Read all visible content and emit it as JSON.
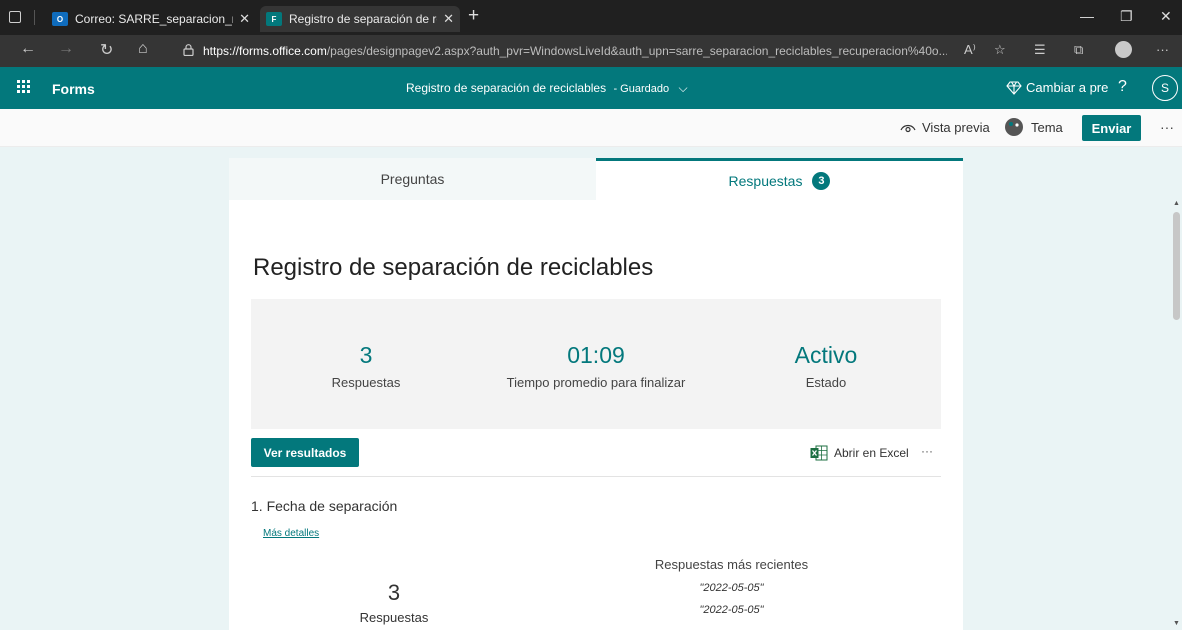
{
  "browser": {
    "tabs": [
      {
        "label": "Correo: SARRE_separacion_recicl",
        "icon": "outlook-icon"
      },
      {
        "label": "Registro de separación de recicla",
        "icon": "forms-icon"
      }
    ],
    "url_domain": "https://forms.office.com",
    "url_rest": "/pages/designpagev2.aspx?auth_pvr=WindowsLiveId&auth_upn=sarre_separacion_reciclables_recuperacion%40o...",
    "read_aloud": "A⁾"
  },
  "header": {
    "brand": "Forms",
    "form_title": "Registro de separación de reciclables",
    "saved": "- Guardado",
    "upgrade": "Cambiar a pre",
    "help": "?",
    "avatar_initial": "S"
  },
  "commands": {
    "preview": "Vista previa",
    "theme": "Tema",
    "send": "Enviar"
  },
  "tabs": {
    "questions": "Preguntas",
    "responses": "Respuestas",
    "responses_count": "3"
  },
  "form": {
    "title": "Registro de separación de reciclables",
    "stats": [
      {
        "value": "3",
        "label": "Respuestas"
      },
      {
        "value": "01:09",
        "label": "Tiempo promedio para finalizar"
      },
      {
        "value": "Activo",
        "label": "Estado"
      }
    ],
    "view_results": "Ver resultados",
    "open_excel": "Abrir en Excel",
    "question1": {
      "title": "1. Fecha de separación",
      "details_link": "Más detalles",
      "count": "3",
      "count_label": "Respuestas",
      "recent_heading": "Respuestas más recientes",
      "recent": [
        "\"2022-05-05\"",
        "\"2022-05-05\""
      ]
    }
  },
  "colors": {
    "accent": "#03787c",
    "page_bg": "#eaf4f5"
  }
}
